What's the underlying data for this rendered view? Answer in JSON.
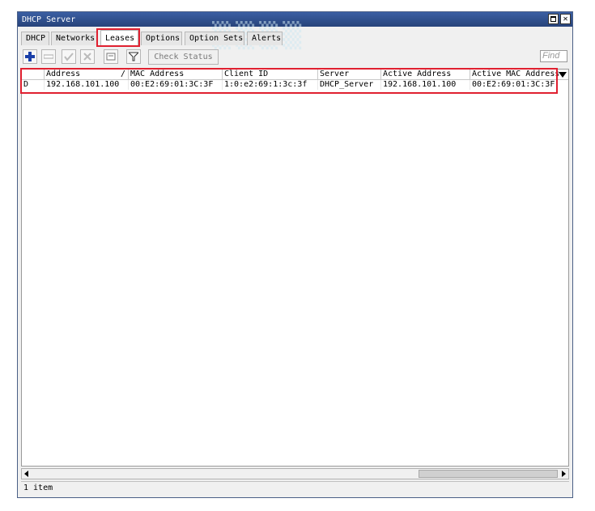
{
  "window": {
    "title": "DHCP Server"
  },
  "tabs": [
    {
      "label": "DHCP"
    },
    {
      "label": "Networks"
    },
    {
      "label": "Leases",
      "active": true
    },
    {
      "label": "Options"
    },
    {
      "label": "Option Sets"
    },
    {
      "label": "Alerts"
    }
  ],
  "toolbar": {
    "buttons": [
      {
        "icon": "plus-icon"
      },
      {
        "icon": "minus-icon"
      },
      {
        "icon": "check-icon"
      },
      {
        "icon": "x-icon"
      },
      {
        "icon": "comment-icon"
      },
      {
        "icon": "filter-icon"
      }
    ],
    "check_status_label": "Check Status",
    "find_placeholder": "Find"
  },
  "table": {
    "columns": [
      "",
      "Address",
      "MAC Address",
      "Client ID",
      "Server",
      "Active Address",
      "Active MAC Address"
    ],
    "sort_indicator": "/",
    "rows": [
      [
        "D",
        "192.168.101.100",
        "00:E2:69:01:3C:3F",
        "1:0:e2:69:1:3c:3f",
        "DHCP_Server",
        "192.168.101.100",
        "00:E2:69:01:3C:3F"
      ]
    ]
  },
  "status": {
    "text": "1 item"
  },
  "colors": {
    "title_bar": "#3b5fa3",
    "highlight": "#e02030"
  }
}
